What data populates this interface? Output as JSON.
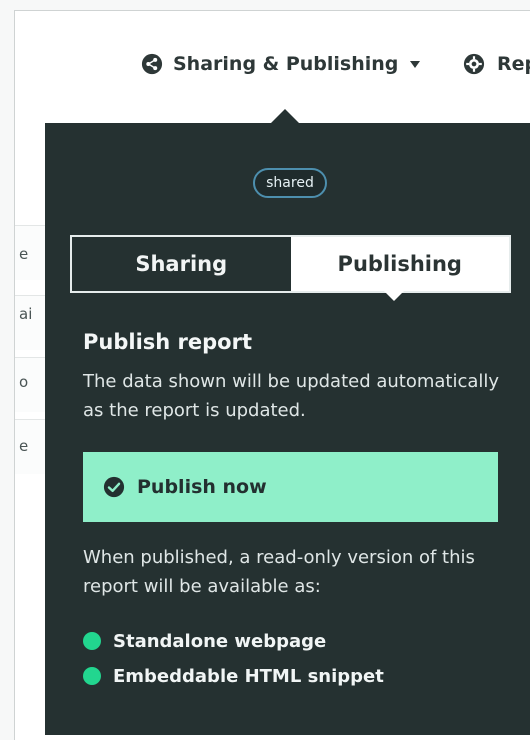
{
  "header": {
    "share_menu_label": "Sharing & Publishing",
    "report_menu_label": "Rep"
  },
  "background_letters": [
    "e",
    "ai",
    "o",
    "e"
  ],
  "popup": {
    "badge": "shared",
    "tabs": [
      {
        "label": "Sharing",
        "active": false
      },
      {
        "label": "Publishing",
        "active": true
      }
    ],
    "title": "Publish report",
    "description": "The data shown will be updated automatically as the report is updated.",
    "publish_button_label": "Publish now",
    "availability_text": "When published, a read-only version of this report will be available as:",
    "formats": [
      {
        "label": "Standalone webpage"
      },
      {
        "label": "Embeddable HTML snippet"
      }
    ]
  },
  "colors": {
    "popup_bg": "#253131",
    "publish_button": "#8fefc9",
    "bullet": "#22d68f",
    "badge_border": "#4d8fae"
  },
  "icons": {
    "share": "share-icon",
    "caret": "caret-down-icon",
    "gear": "gear-icon",
    "check": "check-circle-icon",
    "bullet": "bullet-dot-icon"
  }
}
